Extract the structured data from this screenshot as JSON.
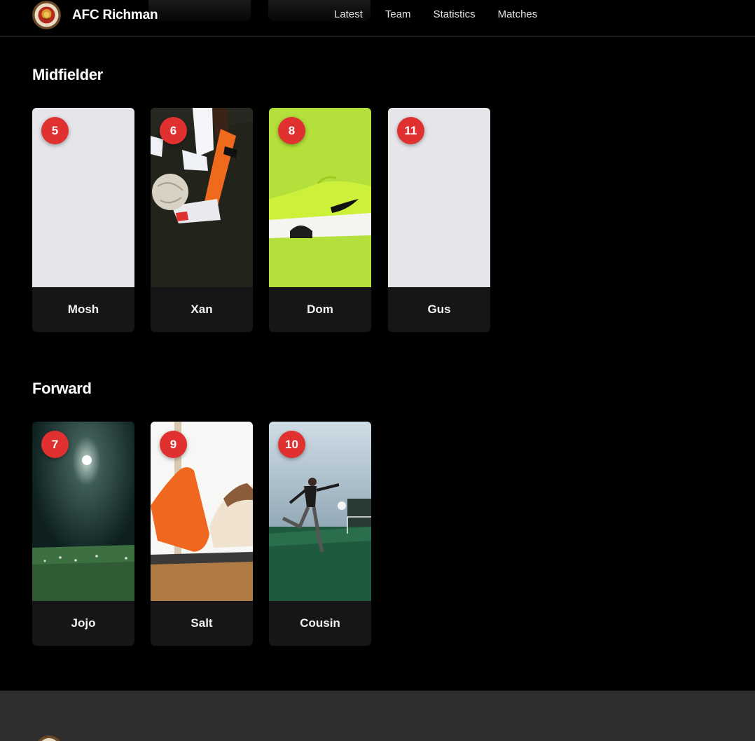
{
  "brand": {
    "name": "AFC Richman",
    "logo_icon": "lion-crest-icon"
  },
  "nav": {
    "items": [
      "Latest",
      "Team",
      "Statistics",
      "Matches"
    ]
  },
  "colors": {
    "background": "#000000",
    "card": "#161616",
    "badge": "#e03030",
    "footer": "#2e2e2e"
  },
  "sections": [
    {
      "title": "Midfielder",
      "players": [
        {
          "number": "5",
          "name": "Mosh",
          "image": "placeholder"
        },
        {
          "number": "6",
          "name": "Xan",
          "image": "football-feet-photo"
        },
        {
          "number": "8",
          "name": "Dom",
          "image": "lime-sneaker-photo"
        },
        {
          "number": "11",
          "name": "Gus",
          "image": "placeholder"
        }
      ]
    },
    {
      "title": "Forward",
      "players": [
        {
          "number": "7",
          "name": "Jojo",
          "image": "night-stadium-photo"
        },
        {
          "number": "9",
          "name": "Salt",
          "image": "orange-leggings-workout-photo"
        },
        {
          "number": "10",
          "name": "Cousin",
          "image": "player-kicking-ball-photo"
        }
      ]
    }
  ]
}
